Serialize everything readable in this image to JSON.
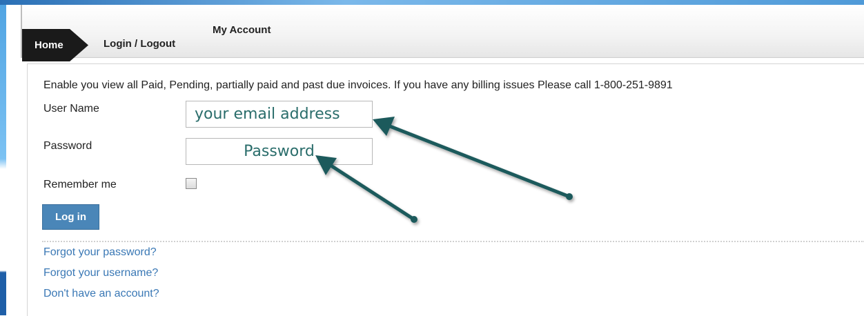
{
  "nav": {
    "home_label": "Home",
    "login_label": "Login / Logout",
    "account_label": "My Account"
  },
  "intro_text": "Enable you view all Paid, Pending, partially paid and past due invoices. If you have any billing issues Please call 1-800-251-9891",
  "form": {
    "username_label": "User Name",
    "username_placeholder": "your email address",
    "password_label": "Password",
    "password_placeholder": "Password",
    "remember_label": "Remember me",
    "remember_checked": false,
    "login_button": "Log in"
  },
  "links": {
    "forgot_password": "Forgot your password?",
    "forgot_username": "Forgot your username?",
    "no_account": "Don't have an account?"
  },
  "colors": {
    "annotation_arrow": "#1e5a5c",
    "link": "#3a78b5",
    "button": "#4a86b8",
    "placeholder_text": "#2a6d6b"
  }
}
